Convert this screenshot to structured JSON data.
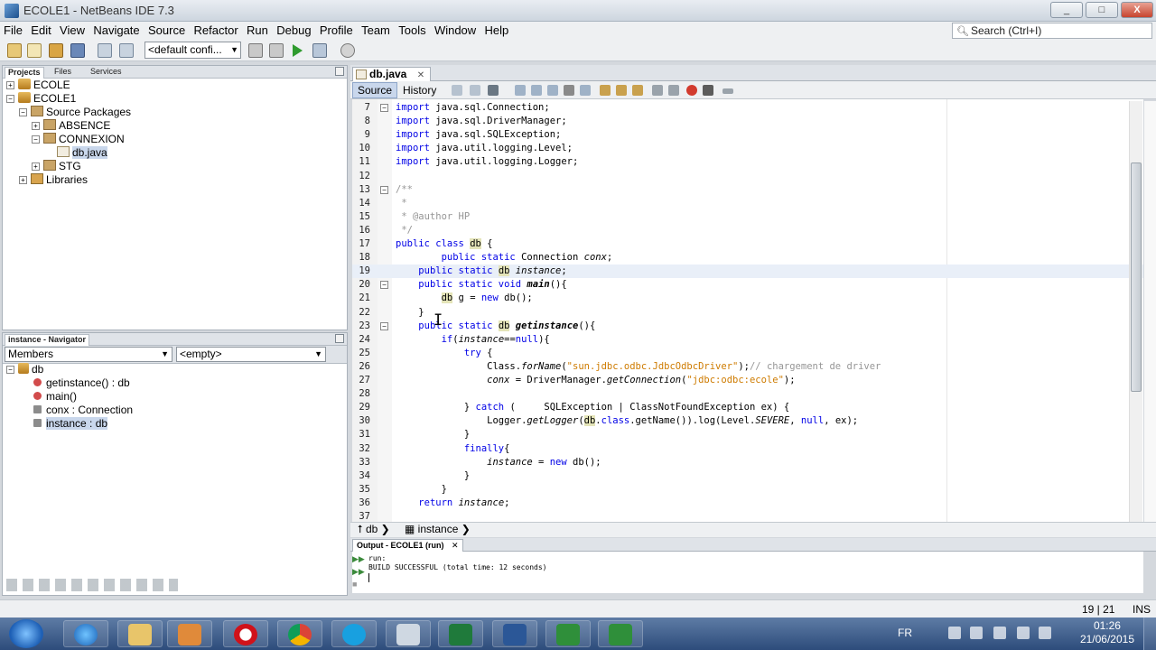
{
  "window": {
    "title": "ECOLE1 - NetBeans IDE 7.3",
    "controls": [
      "_",
      "□",
      "X"
    ]
  },
  "menu": [
    "File",
    "Edit",
    "View",
    "Navigate",
    "Source",
    "Refactor",
    "Run",
    "Debug",
    "Profile",
    "Team",
    "Tools",
    "Window",
    "Help"
  ],
  "search": {
    "placeholder": "Search (Ctrl+I)"
  },
  "toolbar": {
    "config": "<default confi..."
  },
  "projects_panel": {
    "tabs": [
      "Projects",
      "Files",
      "Services"
    ],
    "tree": [
      {
        "label": "ECOLE",
        "expander": "+",
        "icon": "project-icon"
      },
      {
        "label": "ECOLE1",
        "expander": "−",
        "icon": "project-icon"
      },
      {
        "label": "Source Packages",
        "expander": "−",
        "icon": "source-packages-icon"
      },
      {
        "label": "ABSENCE",
        "expander": "+",
        "icon": "package-icon"
      },
      {
        "label": "CONNEXION",
        "expander": "−",
        "icon": "package-icon"
      },
      {
        "label": "db.java",
        "expander": "",
        "icon": "java-file-icon"
      },
      {
        "label": "STG",
        "expander": "+",
        "icon": "package-icon"
      },
      {
        "label": "Libraries",
        "expander": "+",
        "icon": "libraries-icon"
      }
    ]
  },
  "navigator": {
    "title": "instance - Navigator",
    "members_combo": "Members",
    "filter_combo": "<empty>",
    "root": "db",
    "members": [
      {
        "label": "getinstance() : db",
        "color": "#d24b4b"
      },
      {
        "label": "main()",
        "color": "#d24b4b"
      },
      {
        "label": "conx : Connection",
        "color": "#8c8c8c"
      },
      {
        "label": "instance : db",
        "color": "#8c8c8c"
      }
    ]
  },
  "editor": {
    "tab": "db.java",
    "source_btn": "Source",
    "history_btn": "History",
    "lines": [
      {
        "n": "7",
        "fold": "−",
        "html": "<span class=\"kw\">import</span> java.sql.Connection;"
      },
      {
        "n": "8",
        "fold": "",
        "html": "<span class=\"kw\">import</span> java.sql.DriverManager;"
      },
      {
        "n": "9",
        "fold": "",
        "html": "<span class=\"kw\">import</span> java.sql.SQLException;"
      },
      {
        "n": "10",
        "fold": "",
        "html": "<span class=\"kw\">import</span> java.util.logging.Level;"
      },
      {
        "n": "11",
        "fold": "",
        "html": "<span class=\"kw\">import</span> java.util.logging.Logger;"
      },
      {
        "n": "12",
        "fold": "",
        "html": ""
      },
      {
        "n": "13",
        "fold": "−",
        "html": "<span class=\"cm\">/**</span>"
      },
      {
        "n": "14",
        "fold": "",
        "html": "<span class=\"cm\"> *</span>"
      },
      {
        "n": "15",
        "fold": "",
        "html": "<span class=\"cm\"> * @author HP</span>"
      },
      {
        "n": "16",
        "fold": "",
        "html": "<span class=\"cm\"> */</span>"
      },
      {
        "n": "17",
        "fold": "",
        "html": "<span class=\"kw\">public class</span> <span class=\"hl-word\">db</span> {"
      },
      {
        "n": "18",
        "fold": "",
        "html": "        <span class=\"kw\">public static</span> Connection <span class=\"it\">conx</span>;"
      },
      {
        "n": "19",
        "fold": "",
        "hl": true,
        "html": "    <span class=\"kw\">public static</span> <span class=\"hl-word\">db</span> <span class=\"it\">instance</span>;"
      },
      {
        "n": "20",
        "fold": "−",
        "html": "    <span class=\"kw\">public static void</span> <b class=\"it\">main</b>(){"
      },
      {
        "n": "21",
        "fold": "",
        "html": "        <span class=\"hl-word\">db</span> g = <span class=\"kw\">new</span> db();"
      },
      {
        "n": "22",
        "fold": "",
        "html": "    }"
      },
      {
        "n": "23",
        "fold": "−",
        "html": "    <span class=\"kw\">public static</span> <span class=\"hl-word\">db</span> <b class=\"it\">getinstance</b>(){"
      },
      {
        "n": "24",
        "fold": "",
        "html": "        <span class=\"kw\">if</span>(<span class=\"it\">instance</span>==<span class=\"kw\">null</span>){"
      },
      {
        "n": "25",
        "fold": "",
        "html": "            <span class=\"kw\">try</span> {"
      },
      {
        "n": "26",
        "fold": "",
        "html": "                Class.<span class=\"it\">forName</span>(<span class=\"str\">\"sun.jdbc.odbc.JdbcOdbcDriver\"</span>);<span class=\"cm\">// chargement de driver</span>"
      },
      {
        "n": "27",
        "fold": "",
        "html": "                <span class=\"it\">conx</span> = DriverManager.<span class=\"it\">getConnection</span>(<span class=\"str\">\"jdbc:odbc:ecole\"</span>);"
      },
      {
        "n": "28",
        "fold": "",
        "html": ""
      },
      {
        "n": "29",
        "fold": "",
        "html": "            } <span class=\"kw\">catch</span> (     SQLException | ClassNotFoundException ex) {"
      },
      {
        "n": "30",
        "fold": "",
        "html": "                Logger.<span class=\"it\">getLogger</span>(<span class=\"hl-word\">db</span>.<span class=\"kw\">class</span>.getName()).log(Level.<span class=\"it\">SEVERE</span>, <span class=\"kw\">null</span>, ex);"
      },
      {
        "n": "31",
        "fold": "",
        "html": "            }"
      },
      {
        "n": "32",
        "fold": "",
        "html": "            <span class=\"kw\">finally</span>{"
      },
      {
        "n": "33",
        "fold": "",
        "html": "                <span class=\"it\">instance</span> = <span class=\"kw\">new</span> db();"
      },
      {
        "n": "34",
        "fold": "",
        "html": "            }"
      },
      {
        "n": "35",
        "fold": "",
        "html": "        }"
      },
      {
        "n": "36",
        "fold": "",
        "html": "    <span class=\"kw\">return</span> <span class=\"it\">instance</span>;"
      },
      {
        "n": "37",
        "fold": "",
        "html": ""
      }
    ],
    "breadcrumb": [
      "db",
      "instance"
    ]
  },
  "output": {
    "tab": "Output - ECOLE1 (run)",
    "lines": [
      "run:",
      "BUILD SUCCESSFUL (total time: 12 seconds)",
      ""
    ]
  },
  "status": {
    "position": "19 | 21",
    "mode": "INS"
  },
  "taskbar": {
    "lang": "FR",
    "time": "01:26",
    "date": "21/06/2015"
  }
}
